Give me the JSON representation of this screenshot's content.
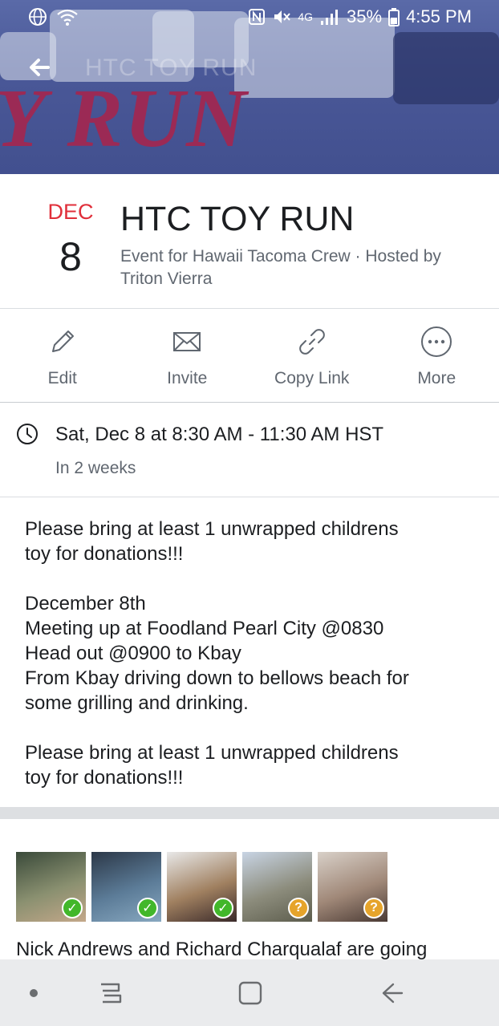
{
  "status_bar": {
    "battery": "35%",
    "time": "4:55 PM",
    "network": "4G"
  },
  "cover": {
    "ghost_title": "HTC TOY RUN",
    "banner_text": "Y RUN"
  },
  "event": {
    "month": "DEC",
    "day": "8",
    "title": "HTC TOY RUN",
    "subtitle": "Event for Hawaii Tacoma Crew · Hosted by Triton Vierra"
  },
  "actions": [
    {
      "label": "Edit",
      "icon": "pencil-icon"
    },
    {
      "label": "Invite",
      "icon": "envelope-icon"
    },
    {
      "label": "Copy Link",
      "icon": "link-icon"
    },
    {
      "label": "More",
      "icon": "more-icon"
    }
  ],
  "time": {
    "main": "Sat, Dec 8 at 8:30 AM - 11:30 AM HST",
    "relative": "In 2 weeks"
  },
  "description": {
    "lines_1": [
      "Please bring at least 1 unwrapped childrens",
      "toy for donations!!!"
    ],
    "lines_2": [
      "December 8th",
      "Meeting up at Foodland Pearl City @0830",
      "Head out @0900 to Kbay",
      "From Kbay driving down to bellows beach for",
      "some grilling and drinking."
    ],
    "lines_3": [
      "Please bring at least 1 unwrapped childrens",
      "toy for donations!!!"
    ]
  },
  "going": {
    "avatars": [
      {
        "status": "going",
        "badge_color": "#42b72a",
        "colors": [
          "#3a4a3a",
          "#8a9070",
          "#c4a88a"
        ]
      },
      {
        "status": "going",
        "badge_color": "#42b72a",
        "colors": [
          "#2c3848",
          "#5c7c98",
          "#88a8c0"
        ]
      },
      {
        "status": "going",
        "badge_color": "#42b72a",
        "colors": [
          "#e8e8e8",
          "#a08060",
          "#3a2a2a"
        ]
      },
      {
        "status": "maybe",
        "badge_color": "#e6a42b",
        "colors": [
          "#c8d4e4",
          "#8c8c7c",
          "#5c5c4c"
        ]
      },
      {
        "status": "maybe",
        "badge_color": "#e6a42b",
        "colors": [
          "#d8d0c8",
          "#a08878",
          "#4a3a34"
        ]
      }
    ],
    "text": "Nick Andrews and Richard Charqualaf are going"
  }
}
